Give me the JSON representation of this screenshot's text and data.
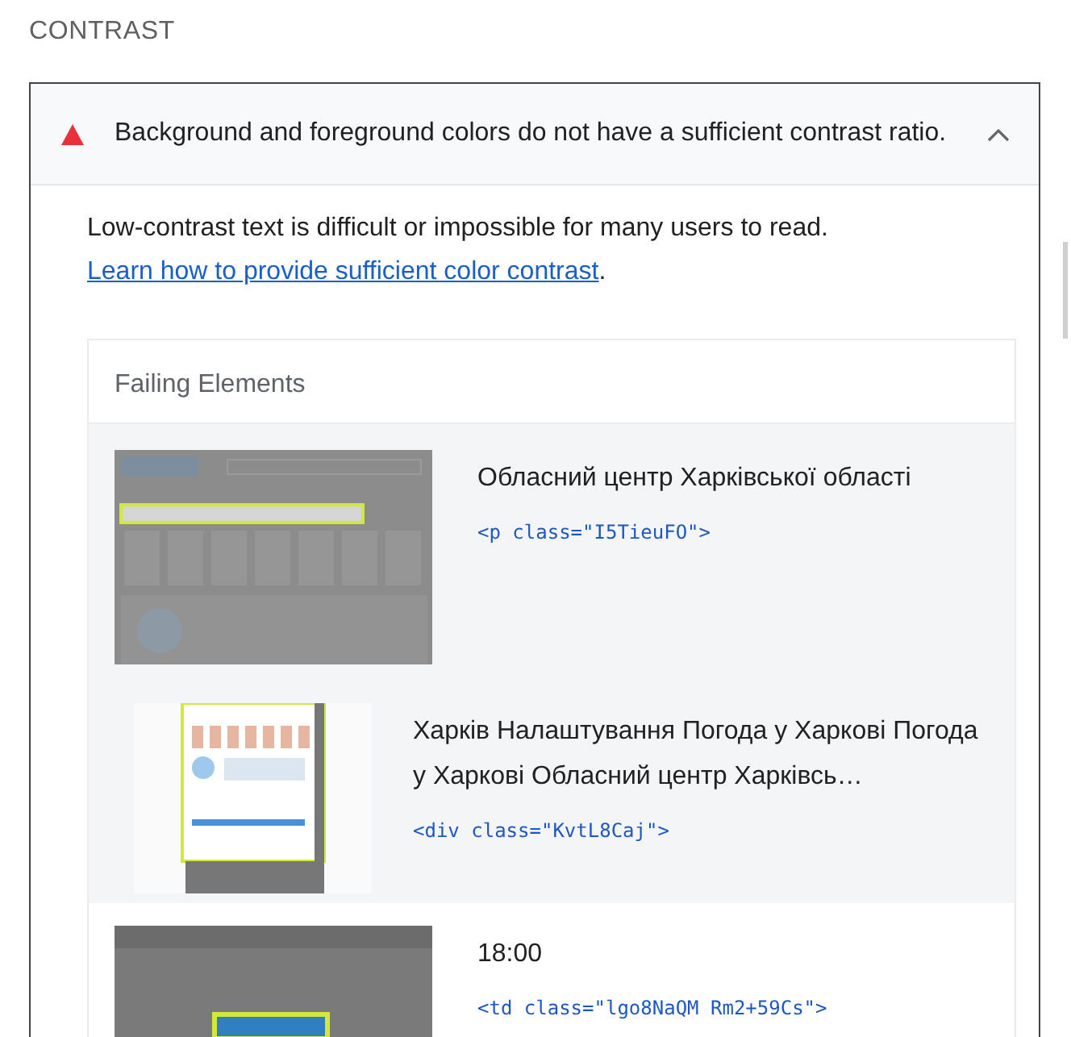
{
  "section_title": "CONTRAST",
  "audit": {
    "kind": "fail",
    "title": "Background and foreground colors do not have a sufficient contrast ratio.",
    "expanded": true,
    "description": "Low-contrast text is difficult or impossible for many users to read.",
    "link": "Learn how to provide sufficient color contrast",
    "description_end": ".",
    "table": {
      "heading": "Failing Elements",
      "rows": [
        {
          "kind": "page",
          "text": "Обласний центр Харківської області",
          "code": "<p class=\"I5TieuFO\">"
        },
        {
          "kind": "full",
          "text": "Харків Налаштування Погода у Харкові Погода у Харкові Обласний центр Харківсь…",
          "code": "<div class=\"KvtL8Caj\">"
        },
        {
          "kind": "crop",
          "text": "18:00",
          "code": "<td class=\"lgo8NaQM Rm2+59Cs\">"
        }
      ]
    }
  }
}
